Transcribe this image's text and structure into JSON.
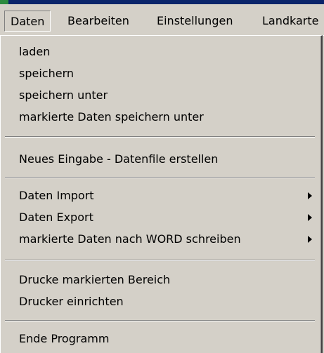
{
  "menubar": {
    "items": [
      {
        "label": "Daten"
      },
      {
        "label": "Bearbeiten"
      },
      {
        "label": "Einstellungen"
      },
      {
        "label": "Landkarte"
      }
    ]
  },
  "dropdown": {
    "items": [
      {
        "label": "laden"
      },
      {
        "label": "speichern"
      },
      {
        "label": "speichern unter"
      },
      {
        "label": "markierte Daten speichern unter"
      },
      {
        "label": "Neues Eingabe - Datenfile erstellen"
      },
      {
        "label": "Daten Import"
      },
      {
        "label": "Daten Export"
      },
      {
        "label": "markierte Daten nach WORD schreiben"
      },
      {
        "label": "Drucke markierten Bereich"
      },
      {
        "label": "Drucker einrichten"
      },
      {
        "label": "Ende Programm"
      }
    ]
  }
}
